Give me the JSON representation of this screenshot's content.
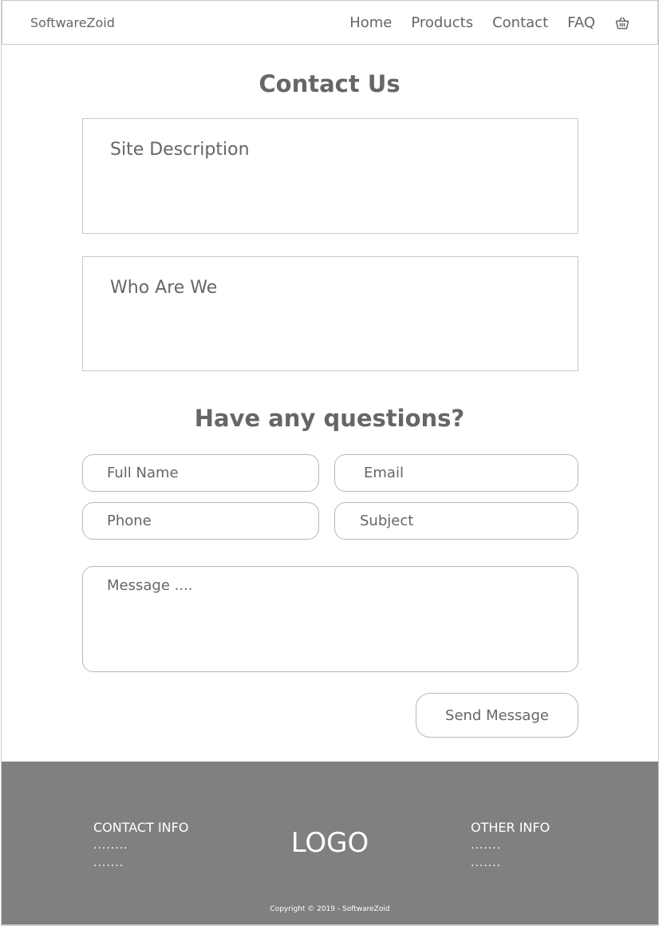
{
  "header": {
    "brand": "SoftwareZoid",
    "nav": [
      {
        "label": "Home"
      },
      {
        "label": "Products"
      },
      {
        "label": "Contact"
      },
      {
        "label": "FAQ"
      }
    ],
    "cart_icon": "basket-icon"
  },
  "main": {
    "title": "Contact Us",
    "site_description": "Site Description",
    "who_are_we": "Who Are We",
    "form_title": "Have any questions?",
    "form": {
      "full_name_placeholder": "Full Name",
      "email_placeholder": "Email",
      "phone_placeholder": "Phone",
      "subject_placeholder": "Subject",
      "message_placeholder": "Message ....",
      "send_label": "Send Message"
    }
  },
  "footer": {
    "contact_info": {
      "heading": "CONTACT INFO",
      "lines": [
        "........",
        "......."
      ]
    },
    "logo": "LOGO",
    "other_info": {
      "heading": "OTHER INFO",
      "lines": [
        ".......",
        "......."
      ]
    },
    "copyright": "Copyright © 2019 - SoftwareZoid"
  },
  "colors": {
    "text": "#666666",
    "border": "#c8c8c8",
    "footer_bg": "#808080",
    "footer_text": "#ffffff"
  }
}
